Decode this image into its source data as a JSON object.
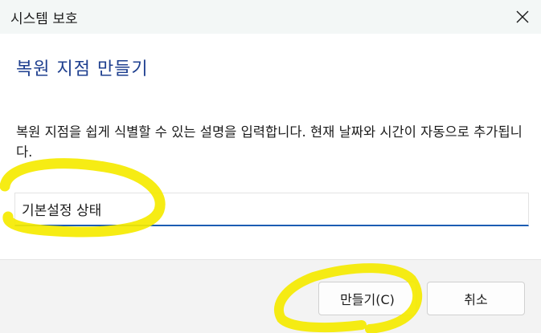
{
  "window": {
    "title": "시스템 보호"
  },
  "main": {
    "heading": "복원 지점 만들기",
    "description": "복원 지점을 쉽게 식별할 수 있는 설명을 입력합니다. 현재 날짜와 시간이 자동으로 추가됩니다.",
    "description_input_value": "기본설정 상태"
  },
  "footer": {
    "create_label": "만들기(C)",
    "cancel_label": "취소"
  },
  "icons": {
    "close": "close-icon"
  },
  "colors": {
    "heading": "#1e3f8f",
    "input_focus": "#1b5db3",
    "annotation_highlight": "#f5ea00",
    "titlebar_bg": "#f3f7f6",
    "footer_bg": "#f3f3f3"
  }
}
